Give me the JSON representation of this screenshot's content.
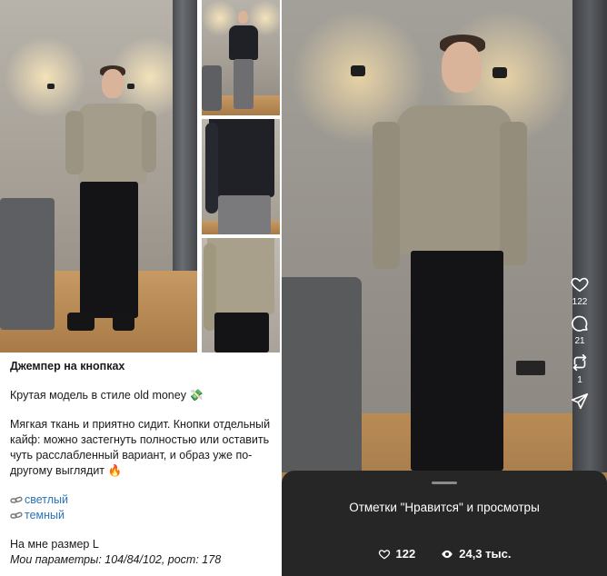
{
  "post": {
    "title": "Джемпер на кнопках",
    "line1": "Крутая модель в стиле old money 💸",
    "line2": "Мягкая ткань и приятно сидит. Кнопки отдельный кайф: можно застегнуть полностью или оставить чуть расслабленный вариант, и образ уже по-другому выглядит 🔥",
    "links": [
      {
        "label": "светлый",
        "icon": "link-icon"
      },
      {
        "label": "темный",
        "icon": "link-icon"
      }
    ],
    "size": "На мне размер L",
    "params": "Мои параметры: 104/84/102, рост: 178"
  },
  "reel": {
    "actions": [
      {
        "icon": "heart-icon",
        "count": "122"
      },
      {
        "icon": "comment-icon",
        "count": "21"
      },
      {
        "icon": "repost-icon",
        "count": "1"
      },
      {
        "icon": "send-icon",
        "count": ""
      }
    ],
    "sheet": {
      "title": "Отметки \"Нравится\" и просмотры",
      "likes": "122",
      "views": "24,3 тыс."
    }
  },
  "colors": {
    "link": "#2a73b8",
    "sheet_bg": "#262626",
    "jumper": "#a59d8c",
    "dark_jumper": "#1f2126",
    "trousers": "#141416"
  }
}
